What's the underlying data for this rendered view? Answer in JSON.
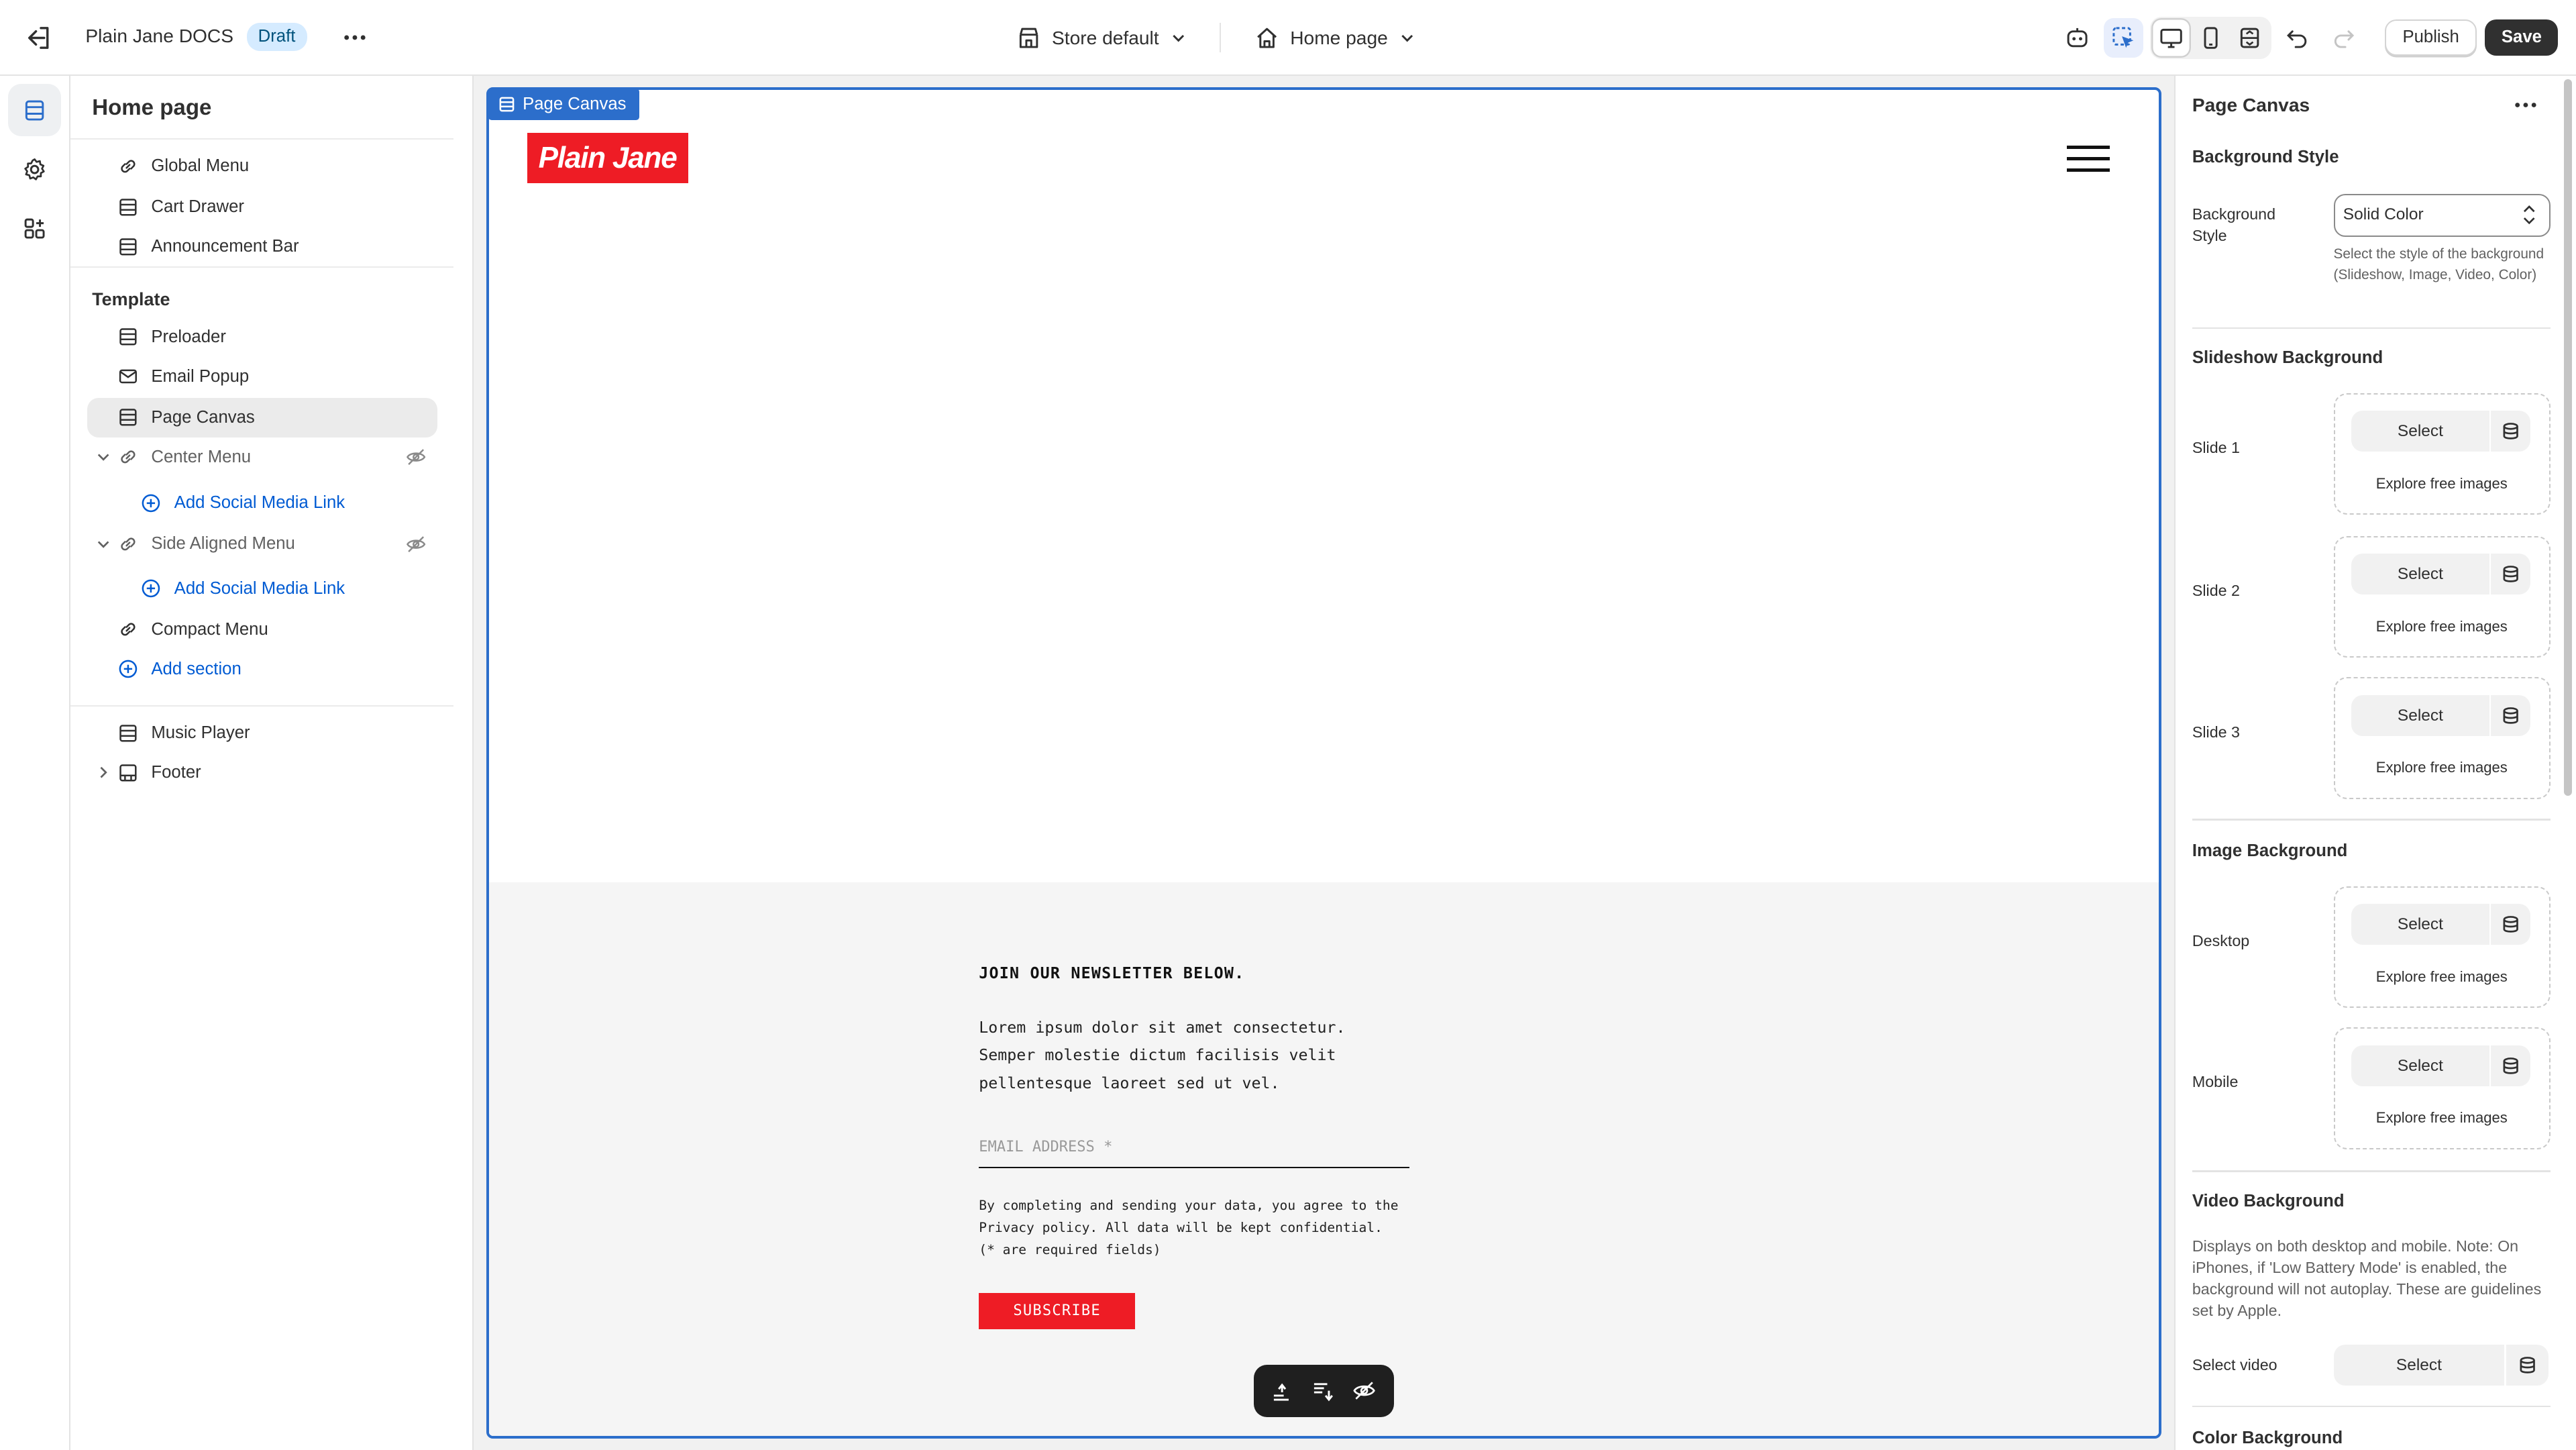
{
  "topbar": {
    "app_title": "Plain Jane DOCS",
    "status_badge": "Draft",
    "store_selector": "Store default",
    "page_selector": "Home page",
    "publish_label": "Publish",
    "save_label": "Save"
  },
  "sidebar": {
    "title": "Home page",
    "header_items": [
      {
        "label": "Global Menu",
        "icon": "link-icon"
      },
      {
        "label": "Cart Drawer",
        "icon": "section-icon"
      },
      {
        "label": "Announcement Bar",
        "icon": "section-icon"
      }
    ],
    "template_heading": "Template",
    "template_items": [
      {
        "label": "Preloader",
        "icon": "section-icon"
      },
      {
        "label": "Email Popup",
        "icon": "mail-icon"
      },
      {
        "label": "Page Canvas",
        "icon": "section-icon",
        "selected": true
      },
      {
        "label": "Center Menu",
        "icon": "link-icon",
        "hidden": true
      },
      {
        "label": "Add Social Media Link",
        "icon": "plus-circle-icon"
      },
      {
        "label": "Side Aligned Menu",
        "icon": "link-icon",
        "hidden": true
      },
      {
        "label": "Add Social Media Link",
        "icon": "plus-circle-icon"
      },
      {
        "label": "Compact Menu",
        "icon": "link-icon"
      },
      {
        "label": "Add section",
        "icon": "plus-circle-icon"
      }
    ],
    "footer_items": [
      {
        "label": "Music Player",
        "icon": "section-icon"
      },
      {
        "label": "Footer",
        "icon": "footer-icon"
      }
    ]
  },
  "canvas": {
    "frame_tag": "Page Canvas",
    "logo_text": "Plain Jane",
    "newsletter": {
      "title": "JOIN OUR NEWSLETTER BELOW.",
      "body_line1": "Lorem ipsum dolor sit amet consectetur.",
      "body_line2": "Semper molestie dictum facilisis velit",
      "body_line3": "pellentesque laoreet sed ut vel.",
      "email_placeholder": "EMAIL ADDRESS *",
      "legal_line1": "By completing and sending your data, you agree to the",
      "legal_line2": "Privacy policy. All data will be kept confidential.",
      "legal_line3": "(* are required fields)",
      "subscribe_label": "SUBSCRIBE"
    }
  },
  "panel": {
    "title": "Page Canvas",
    "bg_style_heading": "Background Style",
    "bg_style_label": "Background Style",
    "bg_style_value": "Solid Color",
    "bg_style_help": "Select the style of the background (Slideshow, Image, Video, Color)",
    "slideshow_heading": "Slideshow Background",
    "slides": [
      {
        "label": "Slide 1",
        "select": "Select",
        "explore": "Explore free images"
      },
      {
        "label": "Slide 2",
        "select": "Select",
        "explore": "Explore free images"
      },
      {
        "label": "Slide 3",
        "select": "Select",
        "explore": "Explore free images"
      }
    ],
    "image_heading": "Image Background",
    "images": [
      {
        "label": "Desktop",
        "select": "Select",
        "explore": "Explore free images"
      },
      {
        "label": "Mobile",
        "select": "Select",
        "explore": "Explore free images"
      }
    ],
    "video_heading": "Video Background",
    "video_help": "Displays on both desktop and mobile. Note: On iPhones, if 'Low Battery Mode' is enabled, the background will not autoplay. These are guidelines set by Apple.",
    "video_label": "Select video",
    "video_select": "Select",
    "color_heading": "Color Background"
  },
  "colors": {
    "accent": "#2c6ecb",
    "brand_red": "#ee1c25",
    "link_blue": "#005bd3"
  }
}
